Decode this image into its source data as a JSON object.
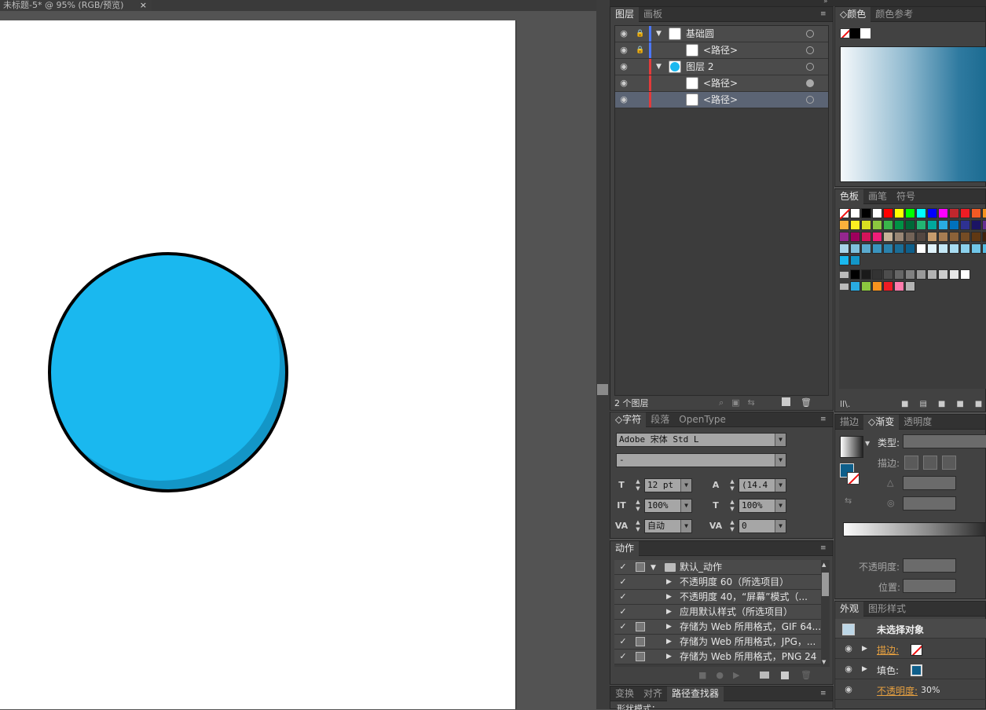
{
  "document": {
    "tab_title": "未标题-5* @ 95% (RGB/预览)",
    "close_glyph": "×",
    "shape_fill": "#1ab8ef",
    "shape_shade": "#1396c7"
  },
  "layers_panel": {
    "tabs": [
      "图层",
      "画板"
    ],
    "rows": [
      {
        "name": "基础圆",
        "indent": 0,
        "expanded": true,
        "locked": true,
        "color": "#4c78ff",
        "thumb": "white",
        "selected": false,
        "target_filled": false
      },
      {
        "name": "<路径>",
        "indent": 1,
        "expanded": null,
        "locked": true,
        "color": "#4c78ff",
        "thumb": "white",
        "selected": false,
        "target_filled": false
      },
      {
        "name": "图层 2",
        "indent": 0,
        "expanded": true,
        "locked": false,
        "color": "#e23b3b",
        "thumb": "blue",
        "selected": false,
        "target_filled": false
      },
      {
        "name": "<路径>",
        "indent": 1,
        "expanded": null,
        "locked": false,
        "color": "#e23b3b",
        "thumb": "white",
        "selected": false,
        "target_filled": true
      },
      {
        "name": "<路径>",
        "indent": 1,
        "expanded": null,
        "locked": false,
        "color": "#e23b3b",
        "thumb": "white",
        "selected": true,
        "target_filled": false
      }
    ],
    "footer_count": "2 个图层"
  },
  "character_panel": {
    "tabs": [
      "字符",
      "段落",
      "OpenType"
    ],
    "font_family": "Adobe 宋体 Std L",
    "font_style": "-",
    "font_size": "12 pt",
    "leading": "(14.4",
    "vertical_scale": "100%",
    "horizontal_scale": "100%",
    "kerning": "自动",
    "tracking": "0"
  },
  "actions_panel": {
    "tab": "动作",
    "set_name": "默认_动作",
    "items": [
      {
        "label": "不透明度 60（所选项目）",
        "dialog": false
      },
      {
        "label": "不透明度 40，“屏幕”模式（...",
        "dialog": false
      },
      {
        "label": "应用默认样式（所选项目）",
        "dialog": false
      },
      {
        "label": "存储为 Web 所用格式，GIF 64...",
        "dialog": true
      },
      {
        "label": "存储为 Web 所用格式，JPG，...",
        "dialog": true
      },
      {
        "label": "存储为 Web 所用格式，PNG 24",
        "dialog": true
      }
    ]
  },
  "bottom_tabs": [
    "变换",
    "对齐",
    "路径查找器"
  ],
  "bottom_partial": "形状模式：",
  "color_panel": {
    "tabs": [
      "颜色",
      "颜色参考"
    ]
  },
  "swatches_panel": {
    "tabs": [
      "色板",
      "画笔",
      "符号"
    ]
  },
  "gradient_panel": {
    "tabs": [
      "描边",
      "渐变",
      "透明度"
    ],
    "type_label": "类型:",
    "stroke_label": "描边:",
    "opacity_label": "不透明度:",
    "position_label": "位置:"
  },
  "appearance_panel": {
    "tabs": [
      "外观",
      "图形样式"
    ],
    "title": "未选择对象",
    "stroke_label": "描边:",
    "fill_label": "填色:",
    "opacity_label": "不透明度:",
    "opacity_value": "30%"
  }
}
